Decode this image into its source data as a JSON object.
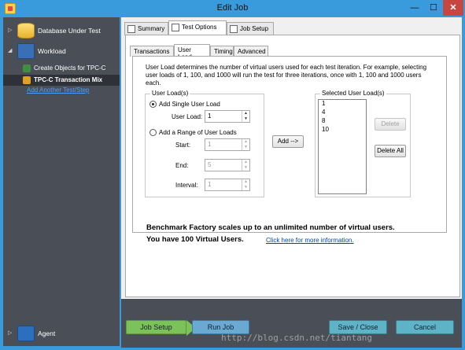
{
  "window": {
    "title": "Edit Job"
  },
  "nav": {
    "items": [
      {
        "label": "Database Under Test"
      },
      {
        "label": "Workload"
      },
      {
        "label": "Agent"
      }
    ],
    "sub_items": [
      {
        "label": "Create Objects for TPC-C"
      },
      {
        "label": "TPC-C Transaction Mix"
      }
    ],
    "add_link": "Add Another Test/Step"
  },
  "tabs": [
    {
      "label": "Summary"
    },
    {
      "label": "Test Options"
    },
    {
      "label": "Job Setup"
    }
  ],
  "inner_tabs": [
    {
      "label": "Transactions"
    },
    {
      "label": "User Load"
    },
    {
      "label": "Timing"
    },
    {
      "label": "Advanced"
    }
  ],
  "description": "User Load determines the number of virtual users used for each test iteration.  For example, selecting user loads of 1, 100, and 1000 will run the test for three iterations, once with 1, 100 and 1000 users each.",
  "user_loads": {
    "group_title": "User Load(s)",
    "single_label": "Add Single User Load",
    "user_load_label": "User Load:",
    "user_load_value": "1",
    "range_label": "Add a Range of User Loads",
    "start_label": "Start:",
    "start_value": "1",
    "end_label": "End:",
    "end_value": "5",
    "interval_label": "Interval:",
    "interval_value": "1"
  },
  "add_button": "Add -->",
  "selected": {
    "group_title": "Selected User Load(s)",
    "items": [
      "1",
      "4",
      "8",
      "10"
    ],
    "delete_button": "Delete",
    "delete_all_button": "Delete All"
  },
  "banner": {
    "line1": "Benchmark Factory scales up to an unlimited number of virtual users.",
    "line2": "You have 100 Virtual Users.",
    "link": "Click here for more information."
  },
  "bottom": {
    "job_setup": "Job Setup",
    "run_job": "Run Job",
    "save_close": "Save / Close",
    "cancel": "Cancel",
    "watermark": "http://blog.csdn.net/tiantang"
  }
}
